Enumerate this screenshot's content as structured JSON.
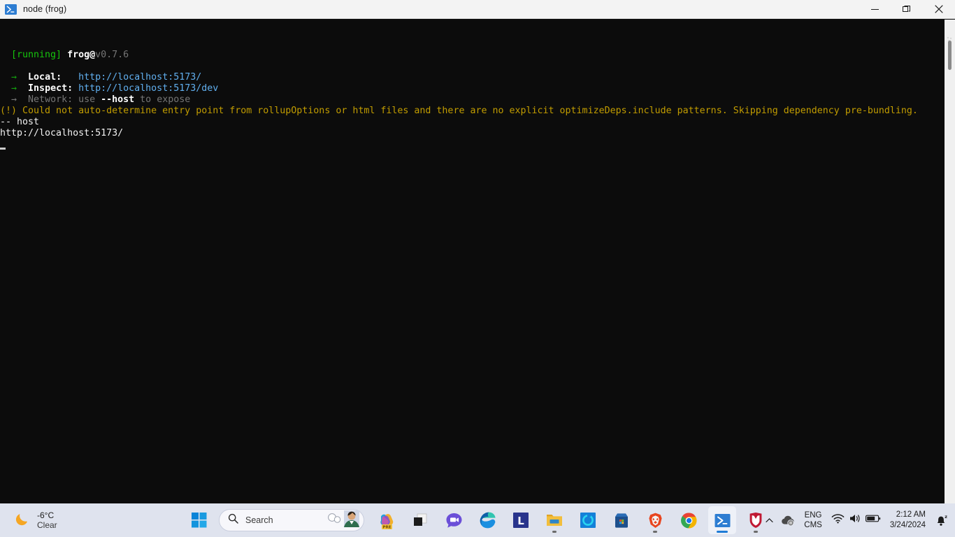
{
  "window": {
    "title": "node (frog)",
    "icon": "powershell-icon",
    "controls": {
      "minimize": "minimize-button",
      "restore": "restore-button",
      "close": "close-button"
    }
  },
  "terminal": {
    "lines": [
      {
        "id": "running-line",
        "segments": [
          {
            "text": "  ",
            "style": "plain"
          },
          {
            "text": "[running]",
            "style": "green"
          },
          {
            "text": " ",
            "style": "plain"
          },
          {
            "text": "frog@",
            "style": "bright"
          },
          {
            "text": "v0.7.6",
            "style": "dim"
          }
        ]
      },
      {
        "id": "blank-1",
        "segments": []
      },
      {
        "id": "local-line",
        "segments": [
          {
            "text": "  ",
            "style": "plain"
          },
          {
            "text": "→",
            "style": "arrow"
          },
          {
            "text": "  ",
            "style": "plain"
          },
          {
            "text": "Local:  ",
            "style": "bright"
          },
          {
            "text": " ",
            "style": "plain"
          },
          {
            "text": "http://localhost:5173/",
            "style": "cyan"
          }
        ]
      },
      {
        "id": "inspect-line",
        "segments": [
          {
            "text": "  ",
            "style": "plain"
          },
          {
            "text": "→",
            "style": "arrow"
          },
          {
            "text": "  ",
            "style": "plain"
          },
          {
            "text": "Inspect:",
            "style": "bright"
          },
          {
            "text": " ",
            "style": "plain"
          },
          {
            "text": "http://localhost:5173/dev",
            "style": "cyan"
          }
        ]
      },
      {
        "id": "network-line",
        "segments": [
          {
            "text": "  ",
            "style": "plain"
          },
          {
            "text": "→",
            "style": "arrow-dim"
          },
          {
            "text": "  ",
            "style": "plain"
          },
          {
            "text": "Network: use ",
            "style": "dim"
          },
          {
            "text": "--host",
            "style": "bright"
          },
          {
            "text": " to expose",
            "style": "dim"
          }
        ]
      },
      {
        "id": "warning-line",
        "segments": [
          {
            "text": "(!) Could not auto-determine entry point from rollupOptions or html files and there are no explicit optimizeDeps.include patterns. Skipping dependency pre-bundling.",
            "style": "yellow"
          }
        ]
      },
      {
        "id": "host-flag-line",
        "segments": [
          {
            "text": "-- host",
            "style": "white"
          }
        ]
      },
      {
        "id": "url-echo-line",
        "segments": [
          {
            "text": "http://localhost:5173/",
            "style": "white"
          }
        ]
      }
    ],
    "cursor": "block-cursor"
  },
  "scrollbar": {
    "name": "terminal-scrollbar"
  },
  "taskbar": {
    "weather": {
      "icon": "crescent-moon-icon",
      "temperature": "-6°C",
      "condition": "Clear"
    },
    "start": {
      "label": "Start",
      "icon": "windows-logo-icon"
    },
    "search": {
      "placeholder": "Search",
      "icon": "search-icon",
      "avatar": "user-avatar"
    },
    "apps": [
      {
        "name": "copilot",
        "label": "Copilot",
        "badge": "PRE",
        "active": false,
        "running": false
      },
      {
        "name": "windows-app",
        "label": "Windows App",
        "active": false,
        "running": false
      },
      {
        "name": "teams-chat",
        "label": "Chat",
        "active": false,
        "running": false
      },
      {
        "name": "microsoft-edge",
        "label": "Microsoft Edge",
        "active": false,
        "running": false
      },
      {
        "name": "lens-l-app",
        "label": "L",
        "active": false,
        "running": false
      },
      {
        "name": "file-explorer",
        "label": "File Explorer",
        "active": false,
        "running": true
      },
      {
        "name": "todoist",
        "label": "Todoist",
        "active": false,
        "running": false
      },
      {
        "name": "microsoft-store",
        "label": "Microsoft Store",
        "active": false,
        "running": false
      },
      {
        "name": "brave-browser",
        "label": "Brave",
        "active": false,
        "running": true
      },
      {
        "name": "google-chrome",
        "label": "Google Chrome",
        "active": false,
        "running": false
      },
      {
        "name": "powershell",
        "label": "Windows PowerShell",
        "active": true,
        "running": true
      },
      {
        "name": "mcafee",
        "label": "McAfee",
        "active": false,
        "running": true
      }
    ],
    "tray": {
      "overflow_icon": "chevron-up-icon",
      "onedrive_icon": "onedrive-paused-icon",
      "language": {
        "line1": "ENG",
        "line2": "CMS"
      },
      "wifi_icon": "wifi-icon",
      "volume_icon": "volume-icon",
      "battery_icon": "battery-icon",
      "clock": {
        "time": "2:12 AM",
        "date": "3/24/2024"
      },
      "notifications_icon": "bell-dnd-icon"
    }
  },
  "colors": {
    "terminal_bg": "#0c0c0c",
    "titlebar_bg": "#f3f3f3",
    "taskbar_bg": "#dfe3ee",
    "accent_blue": "#3b78ff",
    "green": "#16c60c",
    "yellow": "#c19c00"
  }
}
